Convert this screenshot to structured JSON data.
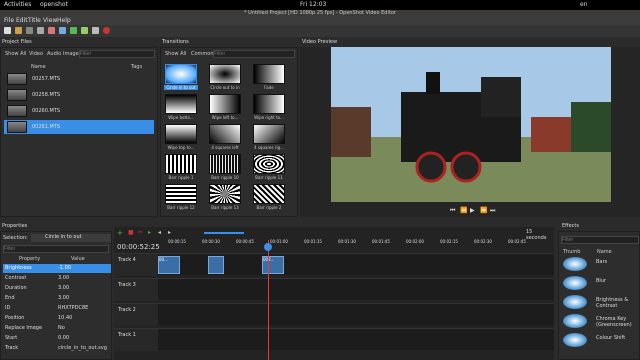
{
  "topbar": {
    "activities": "Activities",
    "app": "openshot",
    "clock": "Fri 12:03",
    "indicators": "en"
  },
  "window": {
    "title": "* Untitled Project [HD 1080p 25 fps] - OpenShot Video Editor"
  },
  "menu": [
    "File",
    "Edit",
    "Title",
    "View",
    "Help"
  ],
  "project_files": {
    "title": "Project Files",
    "tabs": [
      "Show All",
      "Video",
      "Audio",
      "Image"
    ],
    "filter_placeholder": "Filter",
    "columns": [
      "Name",
      "Tags"
    ],
    "files": [
      "00257.MTS",
      "00258.MTS",
      "00260.MTS",
      "00261.MTS"
    ],
    "selected": 3
  },
  "transitions": {
    "title": "Transitions",
    "tabs": [
      "Show All",
      "Common"
    ],
    "filter_placeholder": "Filter",
    "items": [
      "Circle in to out",
      "Circle out to in",
      "Fade",
      "Wipe botto...",
      "Wipe left to...",
      "Wipe right to...",
      "Wipe top to...",
      "4 squares left",
      "4 squares rig...",
      "Barr ripple 1",
      "Barr ripple 10",
      "Barr ripple 11",
      "Barr ripple 12",
      "Barr ripple 13",
      "Barr ripple 2"
    ]
  },
  "preview": {
    "title": "Video Preview"
  },
  "properties": {
    "title": "Properties",
    "selection_label": "Selection:",
    "selection_value": "Circle in to out",
    "filter_placeholder": "Filter",
    "columns": [
      "Property",
      "Value"
    ],
    "rows": [
      [
        "Brightness",
        "-1.00"
      ],
      [
        "Contrast",
        "3.00"
      ],
      [
        "Duration",
        "3.00"
      ],
      [
        "End",
        "3.00"
      ],
      [
        "ID",
        "RHXTPDC8E"
      ],
      [
        "Position",
        "10.40"
      ],
      [
        "Replace Image",
        "No"
      ],
      [
        "Start",
        "0.00"
      ],
      [
        "Track",
        "circle_in_to_out.svg"
      ]
    ]
  },
  "timeline": {
    "timecode": "00:00:52:25",
    "zoom": "15 seconds",
    "ruler": [
      "00:00:15",
      "00:00:30",
      "00:00:45",
      "00:01:00",
      "00:01:15",
      "00:01:30",
      "00:01:45",
      "00:02:00",
      "00:02:15",
      "00:02:30",
      "00:02:45"
    ],
    "tracks": [
      "Track 4",
      "Track 3",
      "Track 2",
      "Track 1"
    ],
    "clips": [
      "00...",
      "",
      "002..."
    ]
  },
  "effects": {
    "title": "Effects",
    "filter_placeholder": "Filter",
    "columns": [
      "Thumb",
      "Name"
    ],
    "items": [
      "Bars",
      "Blur",
      "Brightness & Contrast",
      "Chroma Key (Greenscreen)",
      "Colour Shift"
    ]
  }
}
